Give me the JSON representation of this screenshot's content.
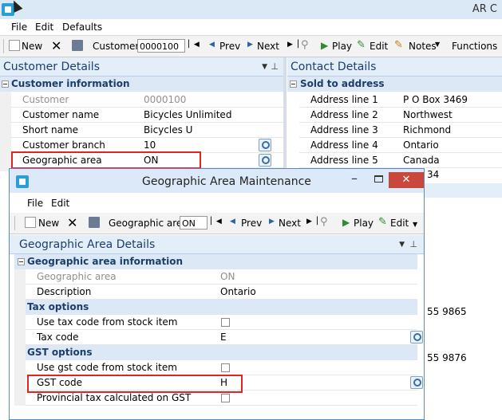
{
  "app": {
    "title": "AR C"
  },
  "menu": {
    "file": "File",
    "edit": "Edit",
    "defaults": "Defaults"
  },
  "toolbar": {
    "new": "New",
    "customer_label": "Customer:",
    "customer_value": "0000100",
    "prev": "Prev",
    "next": "Next",
    "play": "Play",
    "edit": "Edit",
    "notes": "Notes",
    "functions": "Functions"
  },
  "customer_panel": {
    "title": "Customer Details",
    "section": "Customer information",
    "rows": [
      {
        "label": "Customer",
        "value": "0000100"
      },
      {
        "label": "Customer name",
        "value": "Bicycles Unlimited"
      },
      {
        "label": "Short name",
        "value": "Bicycles U"
      },
      {
        "label": "Customer branch",
        "value": "10"
      },
      {
        "label": "Geographic area",
        "value": "ON"
      }
    ]
  },
  "contact_panel": {
    "title": "Contact Details",
    "section": "Sold to address",
    "rows": [
      {
        "label": "Address line 1",
        "value": "P O Box 3469"
      },
      {
        "label": "Address line 2",
        "value": "Northwest"
      },
      {
        "label": "Address line 3",
        "value": "Richmond"
      },
      {
        "label": "Address line 4",
        "value": "Ontario"
      },
      {
        "label": "Address line 5",
        "value": "Canada"
      }
    ],
    "partial_1": "34",
    "partial_2": "55 9865",
    "partial_3": "55 9876"
  },
  "dialog": {
    "title": "Geographic Area Maintenance",
    "close": "✕",
    "menu": {
      "file": "File",
      "edit": "Edit"
    },
    "toolbar": {
      "new": "New",
      "area_label": "Geographic area:",
      "area_value": "ON",
      "prev": "Prev",
      "next": "Next",
      "play": "Play",
      "edit": "Edit"
    },
    "panel_title": "Geographic Area Details",
    "sections": {
      "info": "Geographic area information",
      "tax": "Tax options",
      "gst": "GST options"
    },
    "rows": {
      "geo_area": {
        "label": "Geographic area",
        "value": "ON"
      },
      "description": {
        "label": "Description",
        "value": "Ontario"
      },
      "use_tax": {
        "label": "Use tax code from stock item"
      },
      "tax_code": {
        "label": "Tax code",
        "value": "E"
      },
      "use_gst": {
        "label": "Use gst code from stock item"
      },
      "gst_code": {
        "label": "GST code",
        "value": "H"
      },
      "prov_tax": {
        "label": "Provincial tax calculated on GST"
      }
    }
  },
  "colors": {
    "accent": "#1b3e6b",
    "highlight": "#e02424",
    "close": "#c9483b"
  }
}
